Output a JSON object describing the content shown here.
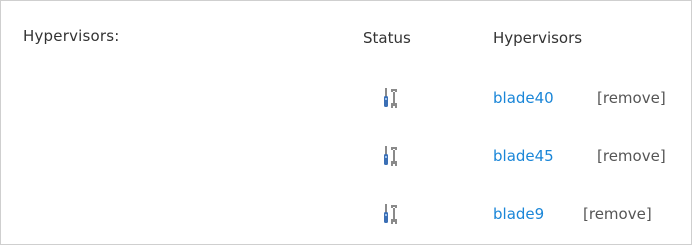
{
  "section_label": "Hypervisors:",
  "columns": {
    "status": "Status",
    "hypervisors": "Hypervisors"
  },
  "icons": {
    "status": "tools-icon",
    "status_colors": {
      "screwdriver_handle": "#3b6fb5",
      "metal": "#8a8a8a"
    }
  },
  "link_color": "#1a86d8",
  "rows": [
    {
      "host": "blade40",
      "remove_open": "[",
      "remove_label": "remove",
      "remove_close": "]"
    },
    {
      "host": "blade45",
      "remove_open": "[",
      "remove_label": "remove",
      "remove_close": "]"
    },
    {
      "host": "blade9",
      "remove_open": "[",
      "remove_label": "remove",
      "remove_close": "]"
    }
  ]
}
